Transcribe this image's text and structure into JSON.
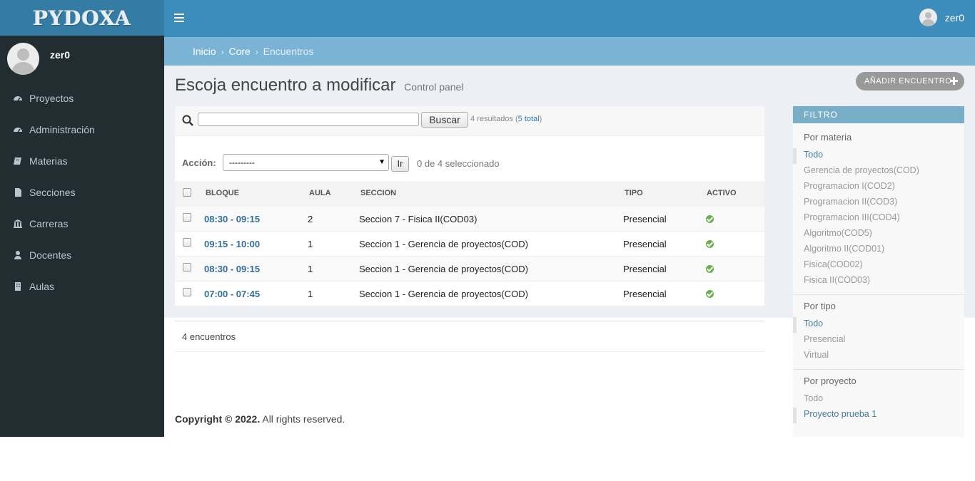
{
  "app": {
    "logo": "PYDOXA"
  },
  "header": {
    "user_name": "zer0"
  },
  "sidebar": {
    "user_name": "zer0",
    "items": [
      {
        "label": "Proyectos",
        "icon": "dashboard-icon"
      },
      {
        "label": "Administración",
        "icon": "dashboard-icon"
      },
      {
        "label": "Materias",
        "icon": "book-icon"
      },
      {
        "label": "Secciones",
        "icon": "file-icon"
      },
      {
        "label": "Carreras",
        "icon": "institution-icon"
      },
      {
        "label": "Docentes",
        "icon": "user-icon"
      },
      {
        "label": "Aulas",
        "icon": "building-icon"
      }
    ]
  },
  "breadcrumb": {
    "home": "Inicio",
    "sep": "›",
    "core": "Core",
    "current": "Encuentros"
  },
  "page": {
    "title": "Escoja encuentro a modificar",
    "subtitle": "Control panel",
    "add_button": "AÑADIR ENCUENTRO"
  },
  "search": {
    "value": "",
    "button": "Buscar",
    "results_prefix": "4 resultados (",
    "total_link": "5 total",
    "results_suffix": ")"
  },
  "actions": {
    "label": "Acción:",
    "selected": "---------",
    "go": "Ir",
    "selection_count": "0 de 4 seleccionado"
  },
  "table": {
    "columns": [
      "BLOQUE",
      "AULA",
      "SECCION",
      "TIPO",
      "ACTIVO"
    ],
    "rows": [
      {
        "bloque": "08:30 - 09:15",
        "aula": "2",
        "seccion": "Seccion 7 - Fisica II(COD03)",
        "tipo": "Presencial",
        "activo": true
      },
      {
        "bloque": "09:15 - 10:00",
        "aula": "1",
        "seccion": "Seccion 1 - Gerencia de proyectos(COD)",
        "tipo": "Presencial",
        "activo": true
      },
      {
        "bloque": "08:30 - 09:15",
        "aula": "1",
        "seccion": "Seccion 1 - Gerencia de proyectos(COD)",
        "tipo": "Presencial",
        "activo": true
      },
      {
        "bloque": "07:00 - 07:45",
        "aula": "1",
        "seccion": "Seccion 1 - Gerencia de proyectos(COD)",
        "tipo": "Presencial",
        "activo": true
      }
    ],
    "footer": "4 encuentros"
  },
  "footer": {
    "copyright_bold": "Copyright © 2022.",
    "copyright_rest": " All rights reserved."
  },
  "filter": {
    "title": "FILTRO",
    "materia": {
      "title": "Por materia",
      "options": [
        "Todo",
        "Gerencia de proyectos(COD)",
        "Programacion I(COD2)",
        "Programacion II(COD3)",
        "Programacion III(COD4)",
        "Algoritmo(COD5)",
        "Algoritmo II(COD01)",
        "Fisica(COD02)",
        "Fisica II(COD03)"
      ],
      "selected": "Todo"
    },
    "tipo": {
      "title": "Por tipo",
      "options": [
        "Todo",
        "Presencial",
        "Virtual"
      ],
      "selected": "Todo"
    },
    "proyecto": {
      "title": "Por proyecto",
      "options": [
        "Todo",
        "Proyecto prueba 1"
      ],
      "selected": "Proyecto prueba 1"
    }
  },
  "colors": {
    "header": "#3c8dbc",
    "logo_bg": "#357ca5",
    "sidebar": "#222d32",
    "breadcrumb_bar": "#7bb3d4",
    "content_bg": "#ecf0f5",
    "filter_head": "#79aec8",
    "active_green": "#6ab04c",
    "link": "#336e98"
  }
}
